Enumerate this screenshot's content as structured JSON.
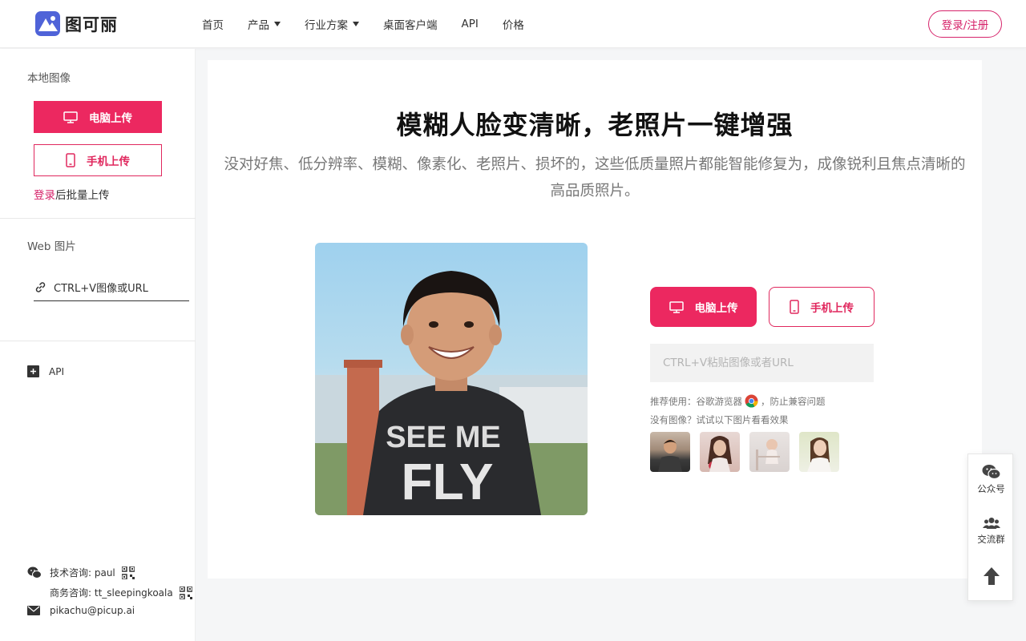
{
  "brand": {
    "name": "图可丽",
    "accent": "#ec2860",
    "logo_color": "#4f63d8"
  },
  "nav": {
    "items": [
      {
        "label": "首页",
        "dropdown": false
      },
      {
        "label": "产品",
        "dropdown": true
      },
      {
        "label": "行业方案",
        "dropdown": true
      },
      {
        "label": "桌面客户端",
        "dropdown": false
      },
      {
        "label": "API",
        "dropdown": false
      },
      {
        "label": "价格",
        "dropdown": false
      }
    ],
    "login_label": "登录/注册"
  },
  "sidebar": {
    "local_title": "本地图像",
    "pc_upload": "电脑上传",
    "phone_upload": "手机上传",
    "batch_link": "登录",
    "batch_text": "后批量上传",
    "web_title": "Web 图片",
    "url_field": "CTRL+V图像或URL",
    "api_label": "API",
    "contacts": {
      "tech": "技术咨询: paul",
      "business": "商务咨询: tt_sleepingkoala",
      "email": "pikachu@picup.ai"
    }
  },
  "main": {
    "title": "模糊人脸变清晰，老照片一键增强",
    "subtitle": "没对好焦、低分辨率、模糊、像素化、老照片、损坏的，这些低质量照片都能智能修复为，成像锐利且焦点清晰的高品质照片。",
    "hero_image_shirt_text": [
      "SEE ME",
      "FLY"
    ],
    "pc_upload": "电脑上传",
    "phone_upload": "手机上传",
    "paste_placeholder": "CTRL+V粘贴图像或者URL",
    "recommend_prefix": "推荐使用：谷歌游览器",
    "recommend_suffix": "，防止兼容问题",
    "samples_hint": "没有图像？试试以下图片看看效果",
    "samples": [
      "sample-boy",
      "sample-woman-rose",
      "sample-baby",
      "sample-woman-white"
    ]
  },
  "float_tools": {
    "wechat": "公众号",
    "group": "交流群"
  }
}
